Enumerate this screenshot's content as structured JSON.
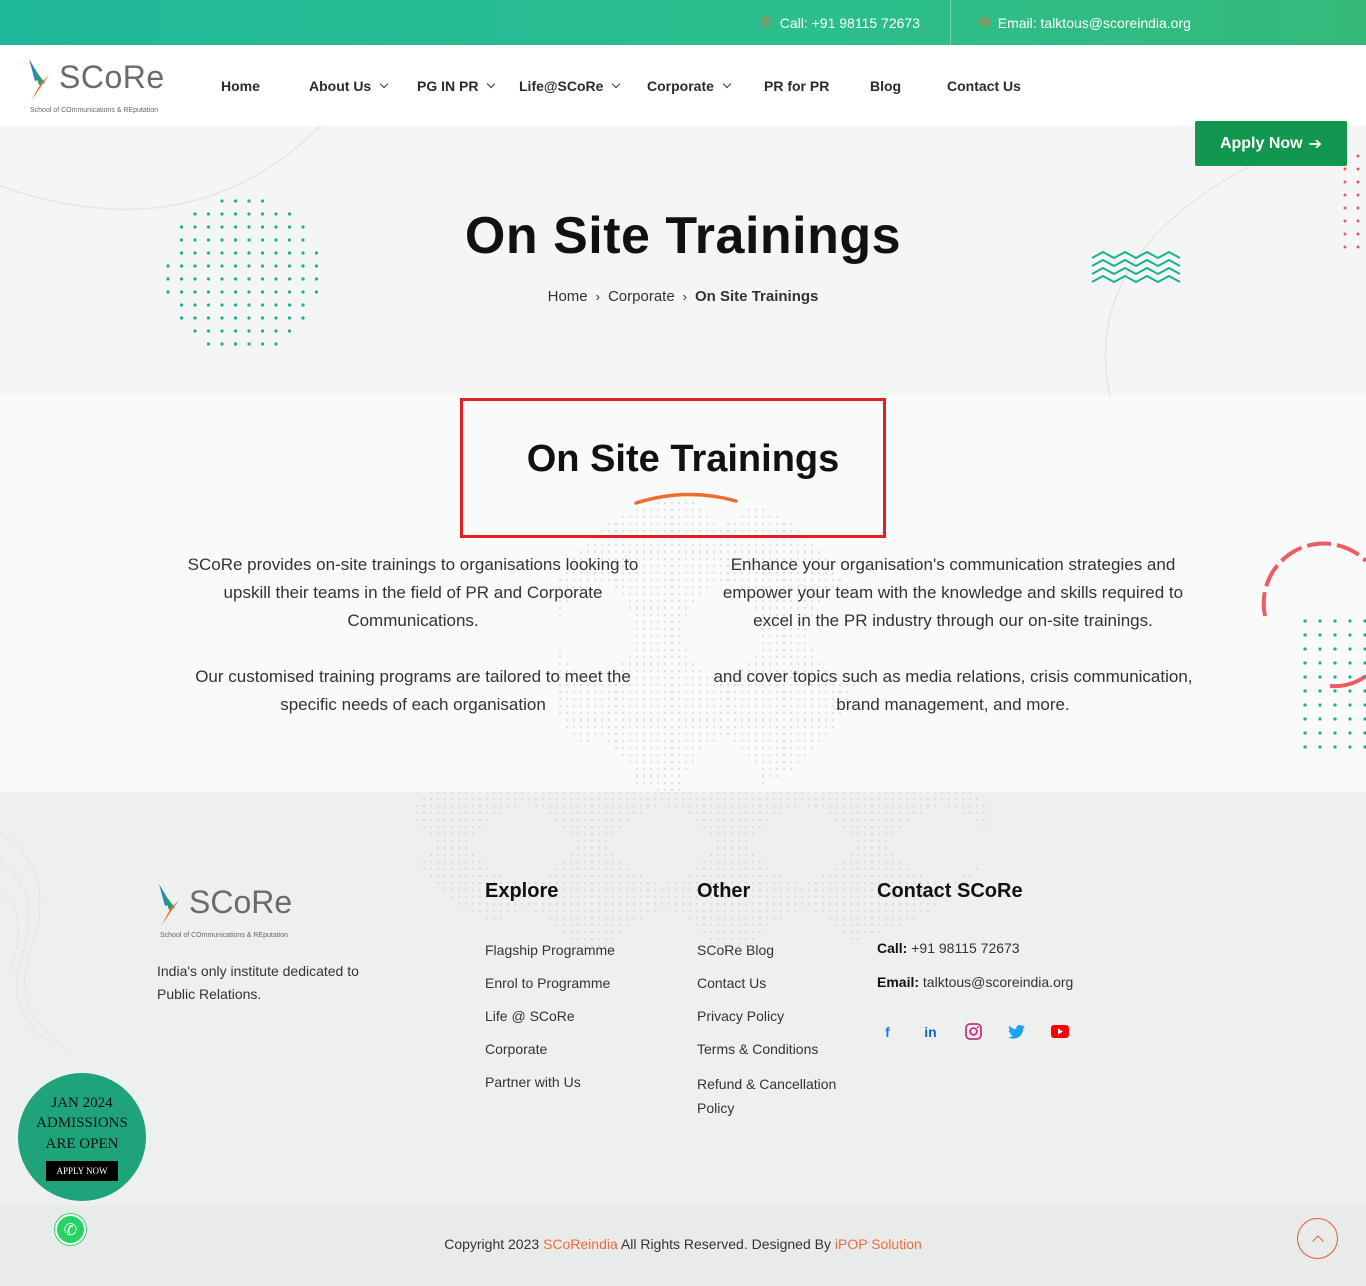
{
  "topbar": {
    "call_label": "Call: +91 98115 72673",
    "email_label": "Email: talktous@scoreindia.org"
  },
  "header": {
    "logo_word": "SCoRe",
    "logo_tagline": "School of COmmunications & REputation",
    "nav": [
      {
        "label": "Home",
        "dropdown": false
      },
      {
        "label": "About Us",
        "dropdown": true
      },
      {
        "label": "PG IN PR",
        "dropdown": true
      },
      {
        "label": "Life@SCoRe",
        "dropdown": true
      },
      {
        "label": "Corporate",
        "dropdown": true
      },
      {
        "label": "PR for PR",
        "dropdown": false
      },
      {
        "label": "Blog",
        "dropdown": false
      },
      {
        "label": "Contact Us",
        "dropdown": false
      }
    ],
    "apply_label": "Apply Now"
  },
  "hero": {
    "title": "On Site Trainings",
    "breadcrumb": [
      "Home",
      "Corporate",
      "On Site Trainings"
    ]
  },
  "content": {
    "section_title": "On Site Trainings",
    "left": [
      "SCoRe provides on-site trainings to organisations looking to upskill their teams in the field of PR and Corporate Communications.",
      "Our customised training programs are tailored to meet the specific needs of each organisation"
    ],
    "right": [
      "Enhance your organisation's communication strategies and empower your team with the knowledge and skills required to excel in the PR industry through our on-site trainings.",
      "and cover topics such as media relations, crisis communication, brand management, and more."
    ]
  },
  "footer": {
    "logo_word": "SCoRe",
    "logo_tagline": "School of COmmunications & REputation",
    "description": "India's only institute dedicated to Public Relations.",
    "explore_title": "Explore",
    "explore": [
      "Flagship Programme",
      "Enrol to Programme",
      "Life @ SCoRe",
      "Corporate",
      "Partner with Us"
    ],
    "other_title": "Other",
    "other": [
      "SCoRe Blog",
      "Contact Us",
      "Privacy Policy",
      "Terms & Conditions",
      "Refund & Cancellation Policy"
    ],
    "contact_title": "Contact SCoRe",
    "call_label": "Call:",
    "call_value": "+91 98115 72673",
    "email_label": "Email:",
    "email_value": "talktous@scoreindia.org",
    "socials": [
      {
        "icon": "facebook-icon",
        "glyph": "f",
        "color": "#1877f2"
      },
      {
        "icon": "linkedin-icon",
        "glyph": "in",
        "color": "#0a66c2"
      },
      {
        "icon": "instagram-icon",
        "glyph": "◎",
        "color": "#c13584"
      },
      {
        "icon": "twitter-icon",
        "glyph": "🐦",
        "color": "#1da1f2"
      },
      {
        "icon": "youtube-icon",
        "glyph": "▶",
        "color": "#ff0000"
      }
    ]
  },
  "copyright": {
    "prefix": "Copyright 2023 ",
    "brand": "SCoReindia",
    "middle": " All Rights Reserved. Designed By ",
    "designer": "iPOP Solution"
  },
  "badge": {
    "line1": "JAN 2024",
    "line2": "ADMISSIONS",
    "line3": "ARE OPEN",
    "button": "APPLY NOW"
  },
  "colors": {
    "brand_green": "#12974e",
    "accent_orange": "#f26b3a",
    "teal": "#20b89a",
    "highlight_red": "#e31e24"
  }
}
